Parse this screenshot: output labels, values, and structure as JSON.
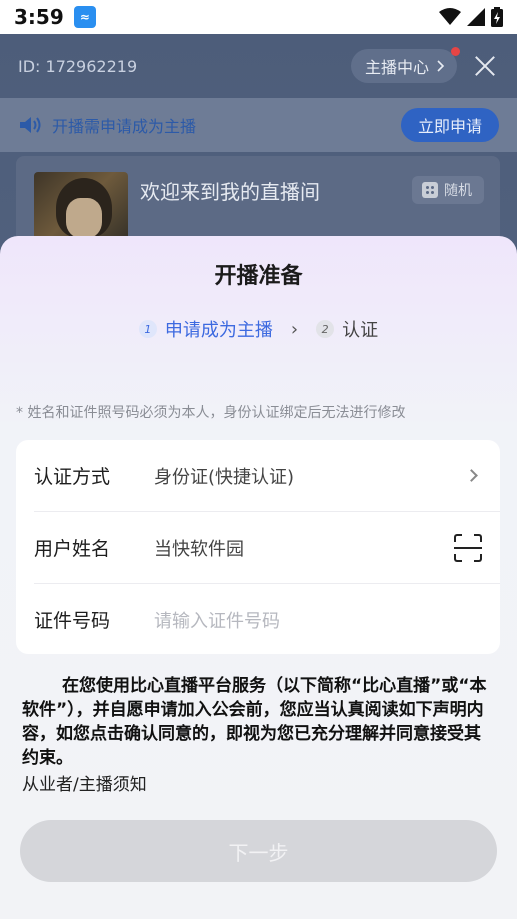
{
  "status_bar": {
    "time": "3:59",
    "app_badge": "≈"
  },
  "room": {
    "user_id": "ID: 172962219",
    "anchor_center": "主播中心",
    "notice_text": "开播需申请成为主播",
    "apply_button": "立即申请",
    "room_title": "欢迎来到我的直播间",
    "random_button": "随机"
  },
  "sheet": {
    "title": "开播准备",
    "steps": [
      {
        "num": "1",
        "label": "申请成为主播",
        "active": true
      },
      {
        "num": "2",
        "label": "认证",
        "active": false
      }
    ],
    "hint": "* 姓名和证件照号码必须为本人，身份认证绑定后无法进行修改",
    "form": {
      "auth_method": {
        "label": "认证方式",
        "value": "身份证(快捷认证)"
      },
      "user_name": {
        "label": "用户姓名",
        "value": "当快软件园"
      },
      "id_number": {
        "label": "证件号码",
        "placeholder": "请输入证件号码"
      }
    },
    "agreement_text": "在您使用比心直播平台服务（以下简称“比心直播”或“本软件”），并自愿申请加入公会前，您应当认真阅读如下声明内容，如您点击确认同意的，即视为您已充分理解并同意接受其约束。",
    "agreement_link": "从业者/主播须知",
    "next_button": "下一步"
  }
}
